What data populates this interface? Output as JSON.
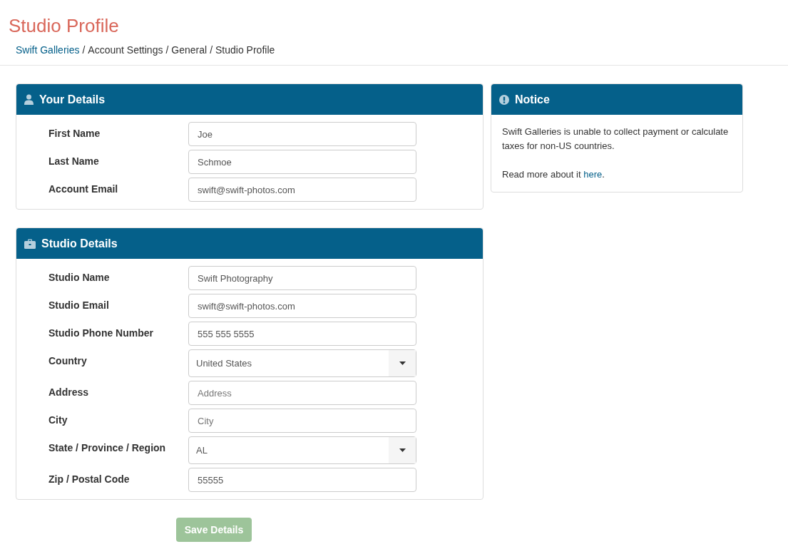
{
  "page_title": "Studio Profile",
  "breadcrumb": [
    {
      "label": "Swift Galleries",
      "kind": "link"
    },
    {
      "label": "/",
      "kind": "separator"
    },
    {
      "label": "Account Settings",
      "kind": "text"
    },
    {
      "label": "/",
      "kind": "separator"
    },
    {
      "label": "General",
      "kind": "text"
    },
    {
      "label": "/",
      "kind": "separator"
    },
    {
      "label": "Studio Profile",
      "kind": "text"
    }
  ],
  "panels": [
    {
      "title": "Your Details",
      "fields": [
        {
          "label": "First Name",
          "kind": "text",
          "value": "Joe"
        },
        {
          "label": "Last Name",
          "kind": "text",
          "value": "Schmoe"
        },
        {
          "label": "Account Email",
          "kind": "text",
          "value": "swift@swift-photos.com"
        }
      ]
    },
    {
      "title": "Studio Details",
      "fields": [
        {
          "label": "Studio Name",
          "kind": "text",
          "value": "Swift Photography"
        },
        {
          "label": "Studio Email",
          "kind": "text",
          "value": "swift@swift-photos.com"
        },
        {
          "label": "Studio Phone Number",
          "kind": "text",
          "value": "555 555 5555"
        },
        {
          "label": "Country",
          "kind": "select",
          "value": "United States"
        },
        {
          "label": "Address",
          "kind": "text",
          "placeholder": "Address"
        },
        {
          "label": "City",
          "kind": "text",
          "placeholder": "City"
        },
        {
          "label": "State / Province / Region",
          "kind": "select",
          "value": "AL"
        },
        {
          "label": "Zip / Postal Code",
          "kind": "text",
          "value": "55555"
        }
      ]
    }
  ],
  "save_button": {
    "label": "Save Details",
    "disabled": true
  },
  "notice": {
    "title": "Notice",
    "paragraph": "Swift Galleries is unable to collect payment or calculate taxes for non-US countries.",
    "more_before": "Read more about it ",
    "more_link": "here",
    "more_after": "."
  }
}
